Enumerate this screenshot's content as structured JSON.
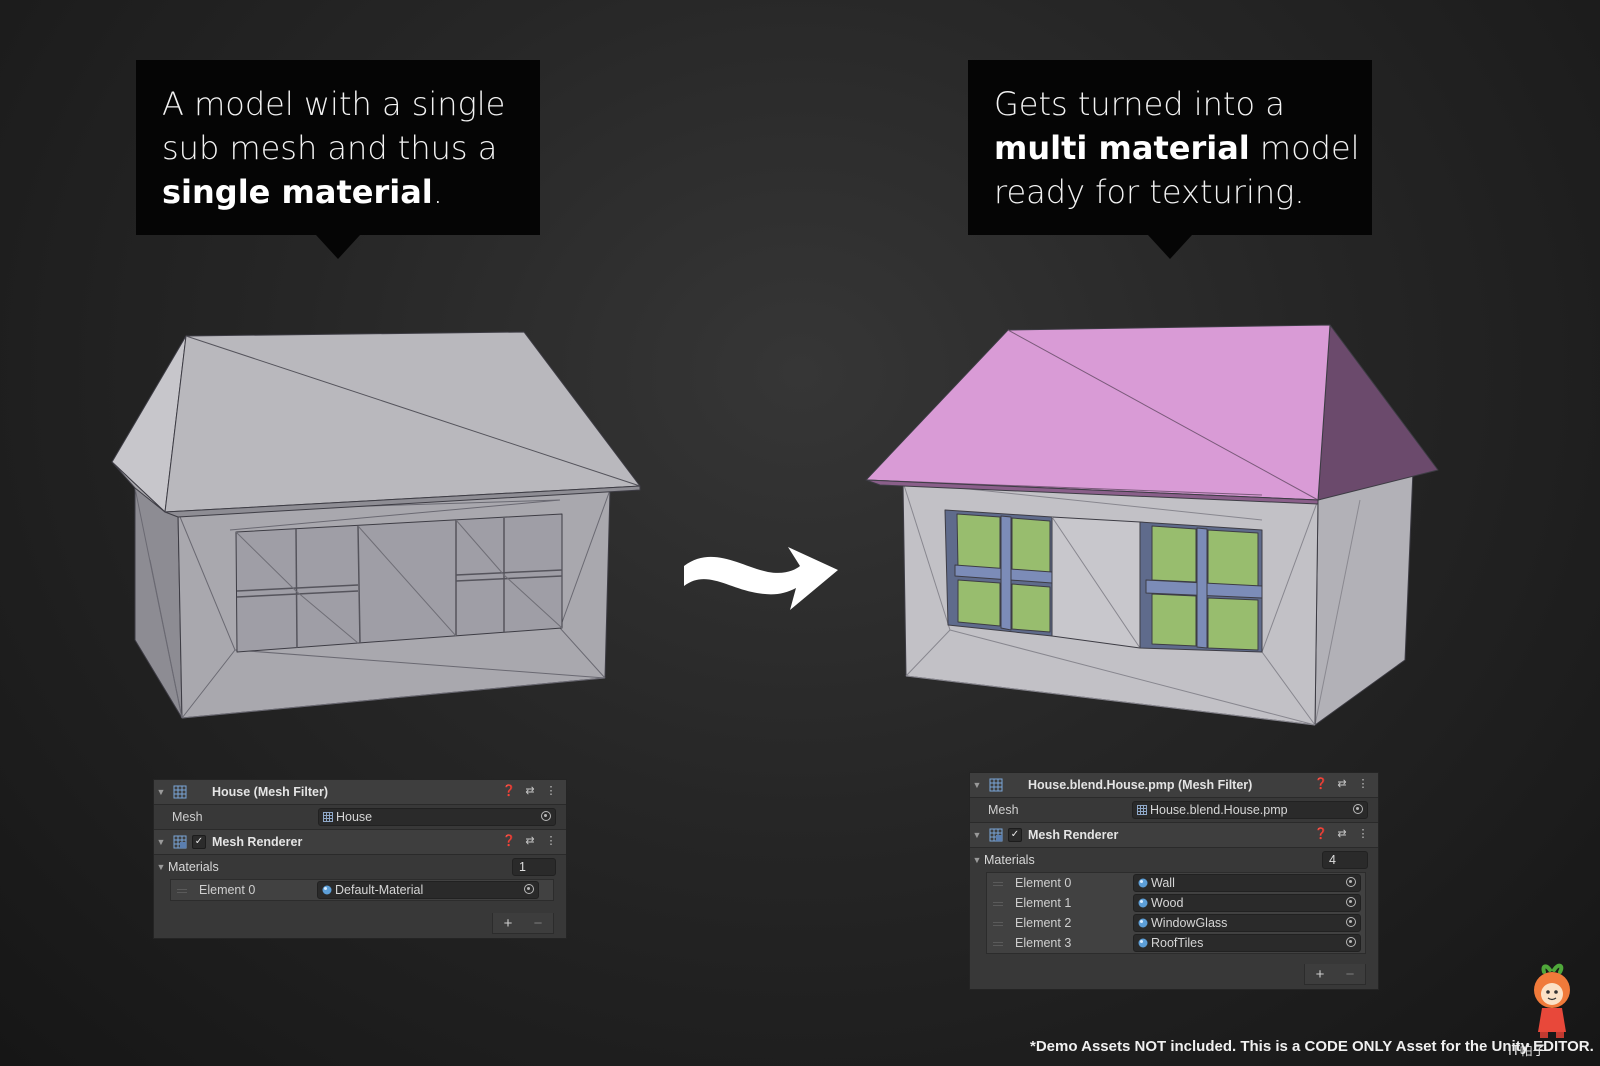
{
  "bubble_left": {
    "line1": "A model with a single",
    "line2": "sub mesh and thus a",
    "line3_bold": "single material",
    "line3_rest": "."
  },
  "bubble_right": {
    "line1": "Gets turned into a",
    "line2_bold": "multi material",
    "line2_rest": " model",
    "line3": "ready for texturing."
  },
  "left_inspector": {
    "mesh_filter_title": "House (Mesh Filter)",
    "mesh_label": "Mesh",
    "mesh_value": "House",
    "renderer_title": "Mesh Renderer",
    "renderer_enabled": true,
    "materials_label": "Materials",
    "materials_count": "1",
    "elements": [
      {
        "label": "Element 0",
        "value": "Default-Material"
      }
    ]
  },
  "right_inspector": {
    "mesh_filter_title": "House.blend.House.pmp (Mesh Filter)",
    "mesh_label": "Mesh",
    "mesh_value": "House.blend.House.pmp",
    "renderer_title": "Mesh Renderer",
    "renderer_enabled": true,
    "materials_label": "Materials",
    "materials_count": "4",
    "elements": [
      {
        "label": "Element 0",
        "value": "Wall"
      },
      {
        "label": "Element 1",
        "value": "Wood"
      },
      {
        "label": "Element 2",
        "value": "WindowGlass"
      },
      {
        "label": "Element 3",
        "value": "RoofTiles"
      }
    ]
  },
  "header_icons": {
    "help": "help-icon",
    "presets": "presets-icon",
    "menu": "kebab-menu-icon"
  },
  "footer_note": "*Demo Assets NOT included. This is a CODE ONLY Asset for the Unity EDITOR.",
  "watermark_text": "IT帕子",
  "colors": {
    "roof_pink": "#d99bd6",
    "wall_gray": "#a9a8ae",
    "glass_green": "#98bd6e",
    "wood_blue": "#7c8cb8",
    "bubble_bg": "#050505"
  }
}
